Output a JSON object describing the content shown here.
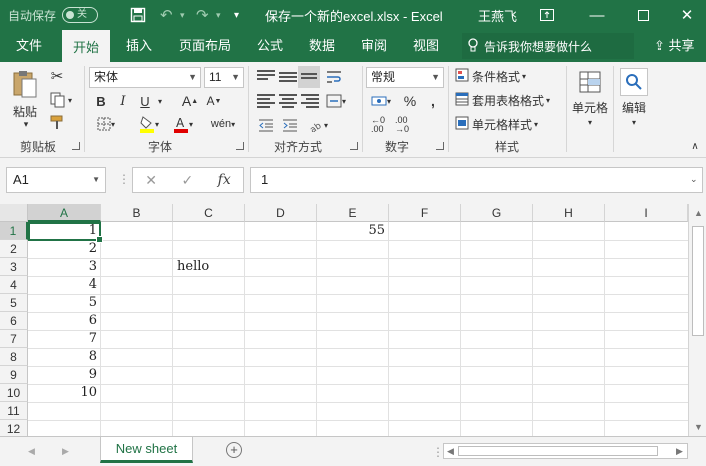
{
  "titlebar": {
    "autosave_label": "自动保存",
    "autosave_state": "关",
    "doc_title": "保存一个新的excel.xlsx  -  Excel",
    "user": "王燕飞"
  },
  "tabs": [
    "文件",
    "开始",
    "插入",
    "页面布局",
    "公式",
    "数据",
    "审阅",
    "视图"
  ],
  "active_tab": "开始",
  "tell_me": "告诉我你想要做什么",
  "share": "共享",
  "ribbon": {
    "clipboard": {
      "paste": "粘贴",
      "label": "剪贴板"
    },
    "font": {
      "name": "宋体",
      "size": "11",
      "label": "字体",
      "bold": "B",
      "italic": "I",
      "underline": "U"
    },
    "alignment": {
      "label": "对齐方式"
    },
    "number": {
      "format": "常规",
      "label": "数字",
      "percent": "%"
    },
    "styles": {
      "conditional": "条件格式",
      "table": "套用表格格式",
      "cell_style": "单元格样式",
      "label": "样式"
    },
    "cells": {
      "label": "单元格"
    },
    "editing": {
      "label": "编辑"
    }
  },
  "formula_bar": {
    "name_box": "A1",
    "fx": "fx",
    "value": "1"
  },
  "columns": [
    "A",
    "B",
    "C",
    "D",
    "E",
    "F",
    "G",
    "H",
    "I"
  ],
  "rows": [
    "1",
    "2",
    "3",
    "4",
    "5",
    "6",
    "7",
    "8",
    "9",
    "10",
    "11",
    "12"
  ],
  "cells": {
    "A": [
      "1",
      "2",
      "3",
      "4",
      "5",
      "6",
      "7",
      "8",
      "9",
      "10"
    ],
    "C3": "hello",
    "E1": "55"
  },
  "sheet_tab": "New sheet",
  "colors": {
    "accent": "#217346"
  }
}
